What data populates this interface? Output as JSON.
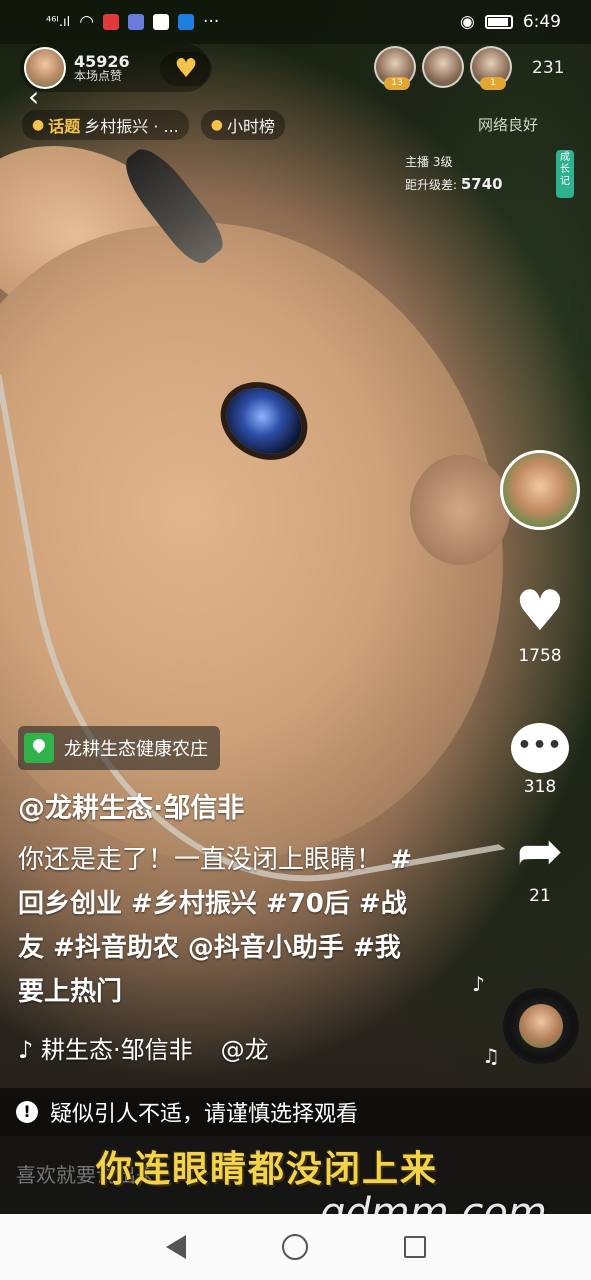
{
  "status_bar": {
    "network": "⁴⁶ᴵ.ıl",
    "time": "6:49",
    "app_icon_colors": [
      "#e23a3a",
      "#ffffff",
      "#6b7ddc",
      "#ffffff",
      "#1e7fe0"
    ]
  },
  "live": {
    "host_count": "45926",
    "host_sub": "本场点赞",
    "viewer_badges": [
      "13",
      "",
      "1"
    ],
    "viewer_count": "231",
    "topic_label": "话题",
    "topic_text": "乡村振兴 · ...",
    "hour_rank": "小时榜",
    "network_status": "网络良好",
    "anchor_label": "主播",
    "anchor_level": "3级",
    "upgrade_label": "距升级差:",
    "upgrade_value": "5740",
    "growth_tag": "成长记"
  },
  "actions": {
    "likes": "1758",
    "comments": "318",
    "shares": "21"
  },
  "post": {
    "location": "龙耕生态健康农庄",
    "author": "@龙耕生态·邹信非",
    "caption_text": "你还是走了！一直没闭上眼睛！",
    "hashtags": "#回乡创业 #乡村振兴 #70后 #战友 #抖音助农 @抖音小助手 #我要上热门",
    "music_prefix": "♪",
    "music_title": "耕生态·邹信非",
    "music_mention": "@龙",
    "warning": "疑似引人不适，请谨慎选择观看",
    "comment_placeholder": "喜欢就要说出来",
    "subtitle": "你连眼睛都没闭上来",
    "watermark": "gdmm.com"
  },
  "colors": {
    "accent_yellow": "#f4c34a",
    "location_green": "#2fb34a",
    "growth_green": "#2fb38f"
  },
  "icons": [
    "back-arrow-icon",
    "heart-icon",
    "comment-icon",
    "share-icon",
    "music-note-icon",
    "warning-icon",
    "location-icon"
  ]
}
